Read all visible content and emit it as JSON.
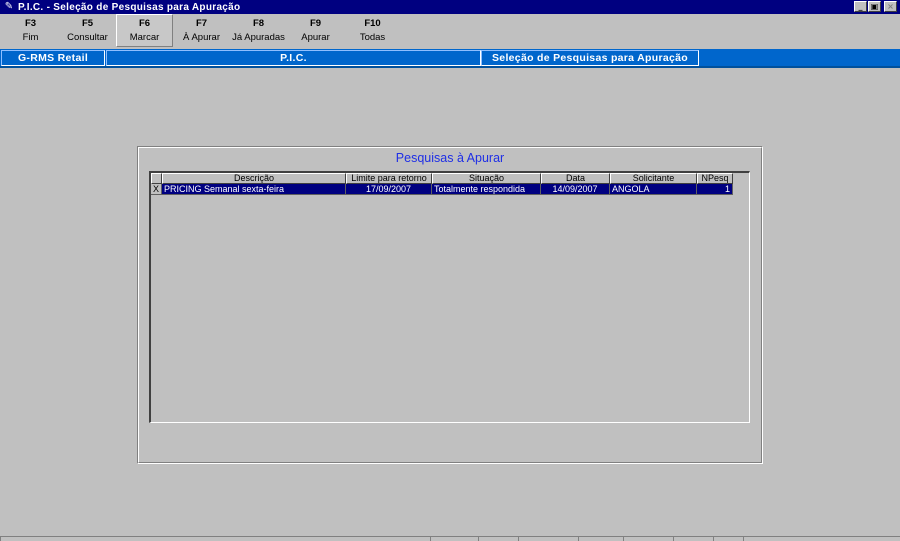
{
  "window": {
    "title": "P.I.C. - Seleção de Pesquisas para Apuração",
    "icon": "pen-icon",
    "buttons": {
      "minimize": "_",
      "maximize": "▣",
      "close": "×"
    }
  },
  "toolbar": {
    "keys": [
      {
        "key": "F3",
        "label": "Fim"
      },
      {
        "key": "F5",
        "label": "Consultar"
      },
      {
        "key": "F6",
        "label": "Marcar",
        "active": true
      },
      {
        "key": "F7",
        "label": "À Apurar"
      },
      {
        "key": "F8",
        "label": "Já Apuradas"
      },
      {
        "key": "F9",
        "label": "Apurar"
      },
      {
        "key": "F10",
        "label": "Todas"
      }
    ]
  },
  "header_band": {
    "left": "G-RMS Retail",
    "middle": "P.I.C.",
    "right": "Seleção de Pesquisas para Apuração"
  },
  "panel": {
    "title": "Pesquisas à Apurar"
  },
  "grid": {
    "columns": [
      "",
      "Descrição",
      "Limite para retorno",
      "Situação",
      "Data",
      "Solicitante",
      "NPesq"
    ],
    "rows": [
      [
        "X",
        "PRICING Semanal sexta-feira",
        "17/09/2007",
        "Totalmente respondida",
        "14/09/2007",
        "ANGOLA",
        "1"
      ]
    ]
  },
  "colors": {
    "title_bar": "#000080",
    "header_band": "#0066cc",
    "panel_title": "#1e2ee6",
    "selection": "#000080",
    "background": "#c0c0c0"
  }
}
